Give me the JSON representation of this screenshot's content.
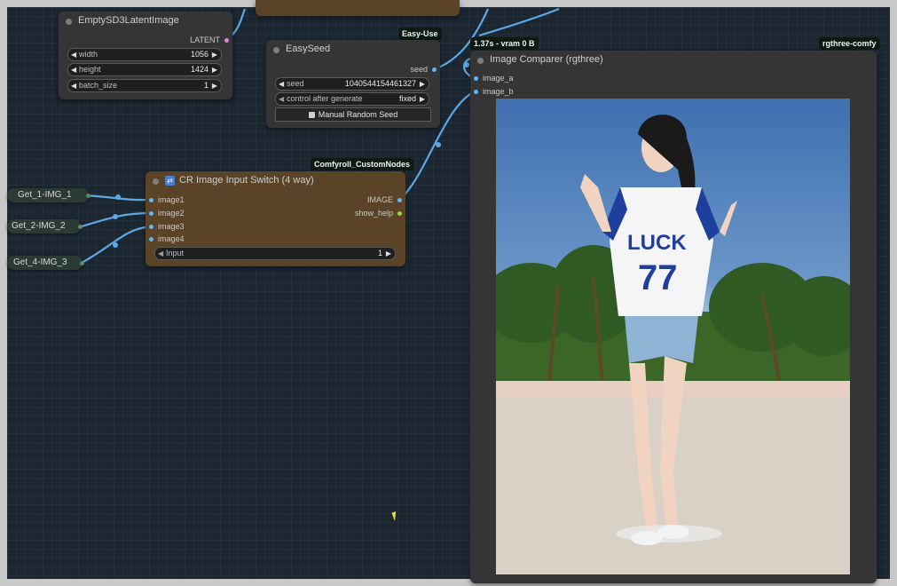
{
  "nodes": {
    "latent": {
      "title": "EmptySD3LatentImage",
      "output": "LATENT",
      "width_label": "width",
      "width_value": "1056",
      "height_label": "height",
      "height_value": "1424",
      "batch_label": "batch_size",
      "batch_value": "1"
    },
    "seed": {
      "title": "EasySeed",
      "badge": "Easy-Use",
      "output": "seed",
      "seed_label": "seed",
      "seed_value": "1040544154461327",
      "control_label": "control after generate",
      "control_value": "fixed",
      "button_label": "Manual Random Seed"
    },
    "switch": {
      "title": "CR Image Input Switch (4 way)",
      "badge": "Comfyroll_CustomNodes",
      "inputs": [
        "image1",
        "image2",
        "image3",
        "image4"
      ],
      "outputs": [
        "IMAGE",
        "show_help"
      ],
      "input_label": "Input",
      "input_value": "1"
    },
    "comparer": {
      "title": "Image Comparer (rgthree)",
      "badge": "rgthree-comfy",
      "timing_badge": "1.37s - vram 0 B",
      "inputs": [
        "image_a",
        "image_b"
      ]
    },
    "get_nodes": [
      "Get_1-IMG_1",
      "Get_2-IMG_2",
      "Get_4-IMG_3"
    ]
  },
  "photo": {
    "shirt_text": "LUCK",
    "shirt_number": "77"
  },
  "colors": {
    "canvas": "#1b2631",
    "node_dark": "#353535",
    "node_brown": "#5a4326",
    "wire": "#5aa9e6",
    "latent_port": "#e87de0",
    "image_port": "#64b5f6",
    "help_port": "#9bd24d"
  }
}
